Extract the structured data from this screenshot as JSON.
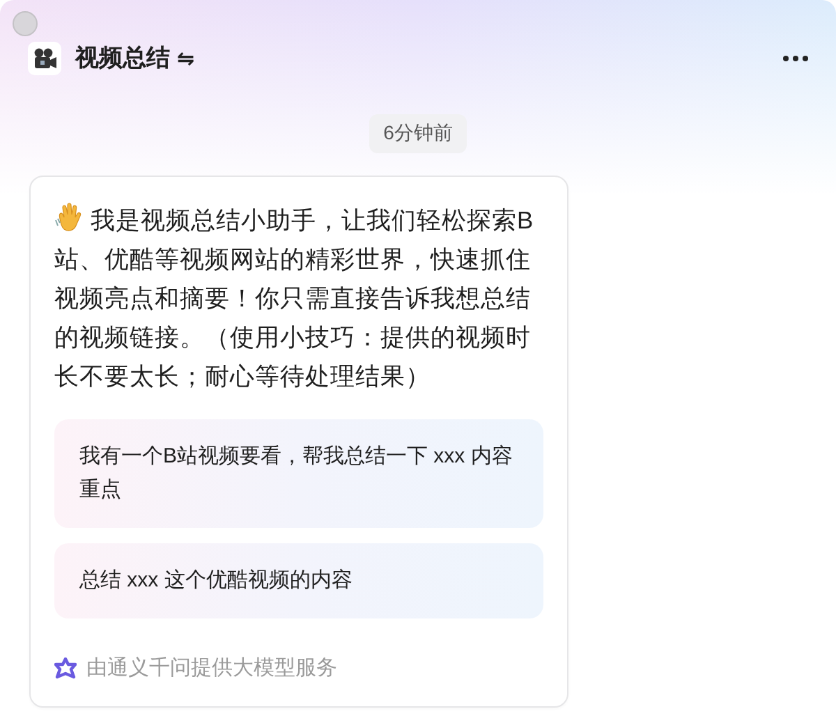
{
  "header": {
    "title": "视频总结",
    "title_symbol": "⇋"
  },
  "timestamp": "6分钟前",
  "message": {
    "text": "我是视频总结小助手，让我们轻松探索B站、优酷等视频网站的精彩世界，快速抓住视频亮点和摘要！你只需直接告诉我想总结的视频链接。（使用小技巧：提供的视频时长不要太长；耐心等待处理结果）",
    "suggestions": [
      "我有一个B站视频要看，帮我总结一下 xxx 内容重点",
      "总结 xxx 这个优酷视频的内容"
    ],
    "footer": "由通义千问提供大模型服务"
  }
}
